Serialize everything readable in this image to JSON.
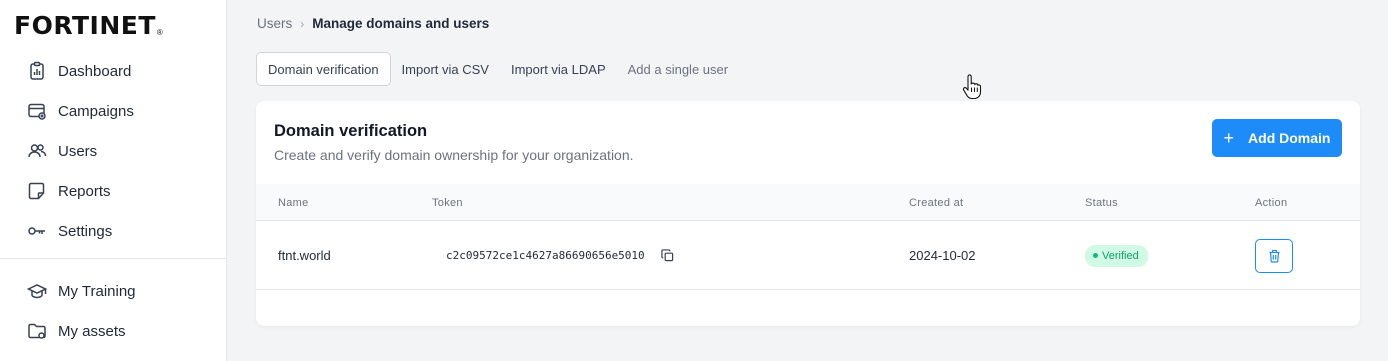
{
  "brand": {
    "logo_text": "FORTINET",
    "logo_mark": "®"
  },
  "sidebar": {
    "items": [
      {
        "label": "Dashboard",
        "icon": "dashboard-icon"
      },
      {
        "label": "Campaigns",
        "icon": "campaigns-icon"
      },
      {
        "label": "Users",
        "icon": "users-icon"
      },
      {
        "label": "Reports",
        "icon": "reports-icon"
      },
      {
        "label": "Settings",
        "icon": "key-icon"
      },
      {
        "label": "My Training",
        "icon": "graduation-cap-icon"
      },
      {
        "label": "My assets",
        "icon": "folder-icon"
      }
    ]
  },
  "breadcrumb": {
    "parent": "Users",
    "separator": "›",
    "current": "Manage domains and users"
  },
  "tabs": [
    {
      "label": "Domain verification",
      "active": true
    },
    {
      "label": "Import via CSV",
      "active": false
    },
    {
      "label": "Import via LDAP",
      "active": false
    },
    {
      "label": "Add a single user",
      "active": false
    }
  ],
  "card": {
    "title": "Domain verification",
    "subtitle": "Create and verify domain ownership for your organization.",
    "add_button": {
      "plus": "+",
      "label": "Add Domain"
    }
  },
  "table": {
    "columns": [
      "Name",
      "Token",
      "Created at",
      "Status",
      "Action"
    ],
    "rows": [
      {
        "name": "ftnt.world",
        "token": "c2c09572ce1c4627a86690656e5010",
        "created_at": "2024-10-02",
        "status": "Verified"
      }
    ]
  },
  "colors": {
    "accent": "#1d8cf8",
    "verified_bg": "#d1fae5",
    "verified_text": "#0f9f6e"
  }
}
